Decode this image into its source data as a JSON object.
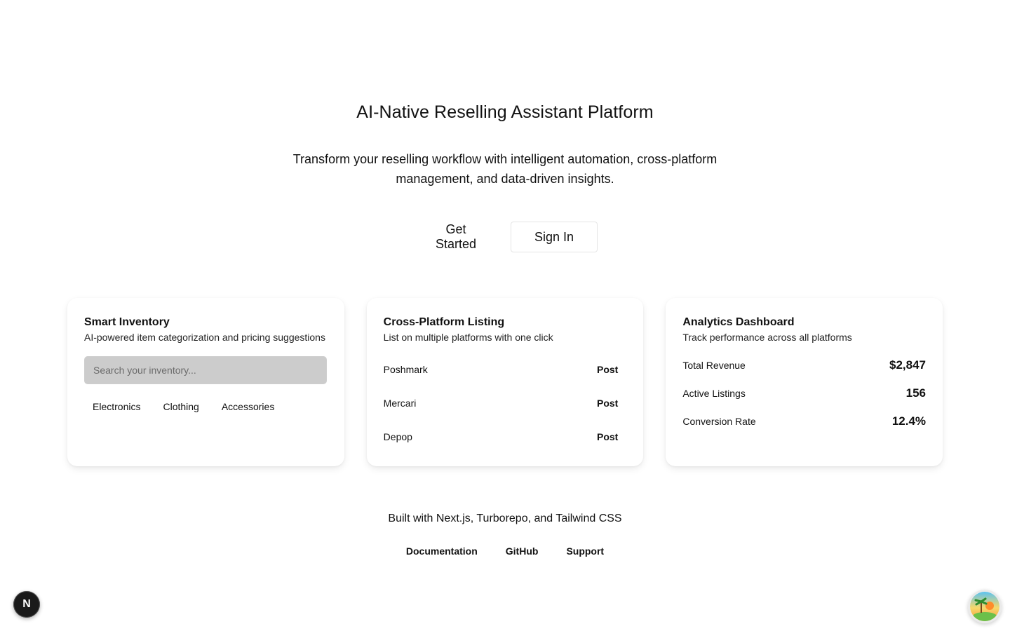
{
  "hero": {
    "title": "AI-Native Reselling Assistant Platform",
    "subtitle": "Transform your reselling workflow with intelligent automation, cross-platform management, and data-driven insights.",
    "get_started_label": "Get Started",
    "sign_in_label": "Sign In"
  },
  "cards": {
    "inventory": {
      "title": "Smart Inventory",
      "description": "AI-powered item categorization and pricing suggestions",
      "search_placeholder": "Search your inventory...",
      "tags": [
        "Electronics",
        "Clothing",
        "Accessories"
      ]
    },
    "listing": {
      "title": "Cross-Platform Listing",
      "description": "List on multiple platforms with one click",
      "platforms": [
        {
          "name": "Poshmark",
          "action": "Post"
        },
        {
          "name": "Mercari",
          "action": "Post"
        },
        {
          "name": "Depop",
          "action": "Post"
        }
      ]
    },
    "analytics": {
      "title": "Analytics Dashboard",
      "description": "Track performance across all platforms",
      "metrics": [
        {
          "label": "Total Revenue",
          "value": "$2,847"
        },
        {
          "label": "Active Listings",
          "value": "156"
        },
        {
          "label": "Conversion Rate",
          "value": "12.4%"
        }
      ]
    }
  },
  "footer": {
    "note": "Built with Next.js, Turborepo, and Tailwind CSS",
    "links": [
      "Documentation",
      "GitHub",
      "Support"
    ]
  },
  "badges": {
    "next_letter": "N"
  },
  "icons": {
    "next_badge": "nextjs-logo-icon",
    "avatar": "island-avatar-icon"
  },
  "colors": {
    "search_bg": "#cccccc",
    "text": "#111111",
    "next_badge_bg": "#1a1a1a"
  }
}
